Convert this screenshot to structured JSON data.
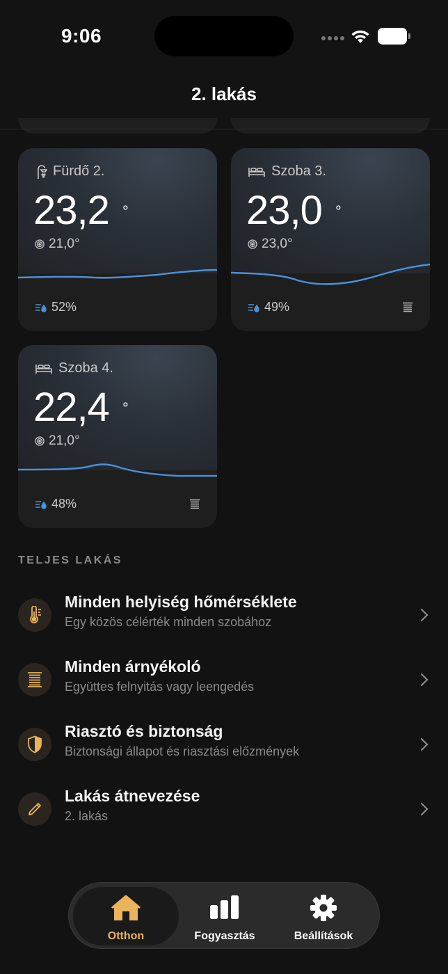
{
  "status": {
    "time": "9:06"
  },
  "header": {
    "title": "2. lakás"
  },
  "rooms": [
    {
      "name": "Fürdő 2.",
      "icon": "shower-icon",
      "temp": "23,2",
      "deg": "°",
      "target": "21,0°",
      "humidity": "52%",
      "has_shade": false
    },
    {
      "name": "Szoba 3.",
      "icon": "bed-icon",
      "temp": "23,0",
      "deg": "°",
      "target": "23,0°",
      "humidity": "49%",
      "has_shade": true
    },
    {
      "name": "Szoba 4.",
      "icon": "bed-icon",
      "temp": "22,4",
      "deg": "°",
      "target": "21,0°",
      "humidity": "48%",
      "has_shade": true
    }
  ],
  "section": {
    "label": "TELJES LAKÁS"
  },
  "items": [
    {
      "title": "Minden helyiség hőmérséklete",
      "subtitle": "Egy közös célérték minden szobához",
      "icon": "thermometer-icon"
    },
    {
      "title": "Minden árnyékoló",
      "subtitle": "Együttes felnyitás vagy leengedés",
      "icon": "blinds-icon"
    },
    {
      "title": "Riasztó és biztonság",
      "subtitle": "Biztonsági állapot és riasztási előzmények",
      "icon": "shield-icon"
    },
    {
      "title": "Lakás átnevezése",
      "subtitle": "2. lakás",
      "icon": "pencil-icon"
    }
  ],
  "tabs": [
    {
      "label": "Otthon",
      "icon": "house-icon",
      "active": true
    },
    {
      "label": "Fogyasztás",
      "icon": "bar-chart-icon",
      "active": false
    },
    {
      "label": "Beállítások",
      "icon": "gear-icon",
      "active": false
    }
  ],
  "colors": {
    "accent": "#E9B45B",
    "graph": "#4A90D9",
    "humidity": "#4A90D9"
  }
}
